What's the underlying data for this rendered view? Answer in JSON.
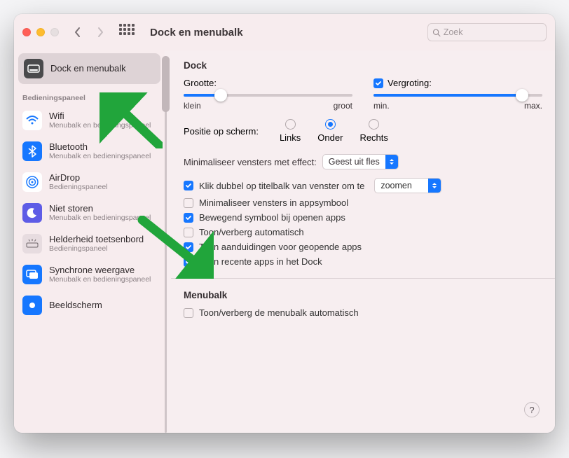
{
  "toolbar": {
    "title": "Dock en menubalk",
    "search_placeholder": "Zoek"
  },
  "sidebar": {
    "selected": {
      "label": "Dock en menubalk"
    },
    "section_header": "Bedieningspaneel",
    "items": [
      {
        "name": "wifi",
        "label": "Wifi",
        "sub": "Menubalk en bedieningspaneel"
      },
      {
        "name": "bluetooth",
        "label": "Bluetooth",
        "sub": "Menubalk en bedieningspaneel"
      },
      {
        "name": "airdrop",
        "label": "AirDrop",
        "sub": "Bedieningspaneel"
      },
      {
        "name": "dnd",
        "label": "Niet storen",
        "sub": "Menubalk en bedieningspaneel"
      },
      {
        "name": "keyboardbrightness",
        "label": "Helderheid toetsenbord",
        "sub": "Bedieningspaneel"
      },
      {
        "name": "mirror",
        "label": "Synchrone weergave",
        "sub": "Menubalk en bedieningspaneel"
      },
      {
        "name": "display",
        "label": "Beeldscherm",
        "sub": ""
      }
    ]
  },
  "dock": {
    "section_title": "Dock",
    "size_label": "Grootte:",
    "size_min": "klein",
    "size_max": "groot",
    "size_percent": 22,
    "magnification_label": "Vergroting:",
    "magnification_min": "min.",
    "magnification_max": "max.",
    "magnification_percent": 88,
    "position_label": "Positie op scherm:",
    "position_options": [
      "Links",
      "Onder",
      "Rechts"
    ],
    "minimize_effect_label": "Minimaliseer vensters met effect:",
    "minimize_effect_value": "Geest uit fles",
    "doubleclick_label": "Klik dubbel op titelbalk van venster om te",
    "doubleclick_value": "zoomen",
    "minimize_into_app_label": "Minimaliseer vensters in appsymbool",
    "animate_label": "Bewegend symbool bij openen apps",
    "autohide_label": "Toon/verberg automatisch",
    "indicators_label": "Toon aanduidingen voor geopende apps",
    "recent_label": "Toon recente apps in het Dock"
  },
  "menubar": {
    "section_title": "Menubalk",
    "autohide_label": "Toon/verberg de menubalk automatisch"
  }
}
